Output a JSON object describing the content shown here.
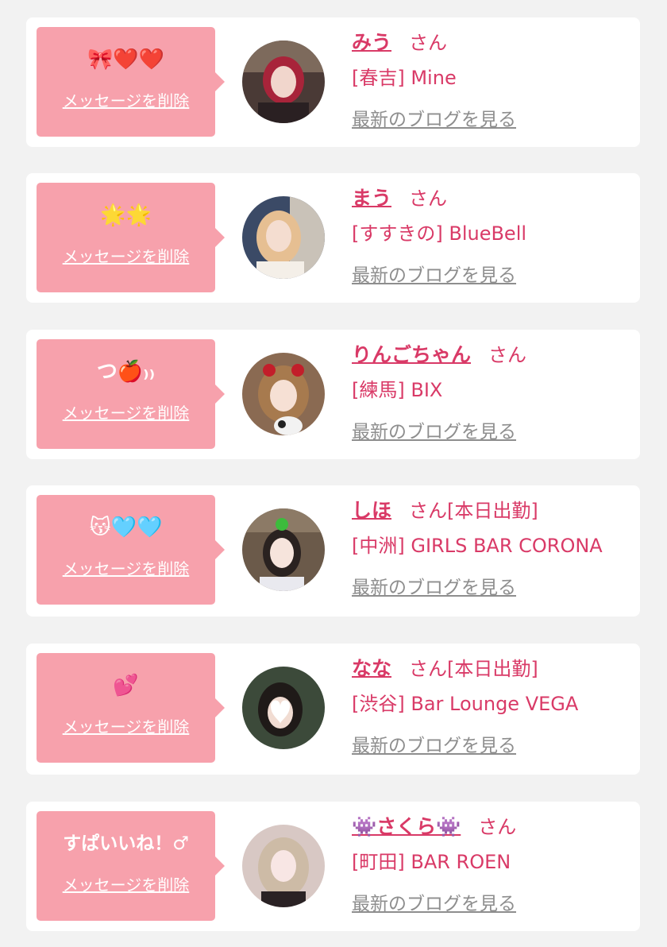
{
  "delete_label": "メッセージを削除",
  "blog_label": "最新のブログを見る",
  "san_label": "さん",
  "colors": {
    "background": "#f2f2f2",
    "card": "#ffffff",
    "bubble": "#f7a1ac",
    "accent_text": "#d93a67",
    "link_gray": "#8e8e8e"
  },
  "items": [
    {
      "message": "🎀❤️❤️",
      "name": "みう",
      "status": "",
      "shop": "[春吉] Mine"
    },
    {
      "message": "🌟🌟",
      "name": "まう",
      "status": "",
      "shop": "[すすきの] BlueBell"
    },
    {
      "message": "つ🍎₎₎",
      "name": "りんごちゃん",
      "status": "",
      "shop": "[練馬] BIX"
    },
    {
      "message": "😽🩵🩵",
      "name": "しほ",
      "status": "[本日出勤]",
      "shop": "[中洲] GIRLS BAR CORONA"
    },
    {
      "message": "💕",
      "name": "なな",
      "status": "[本日出勤]",
      "shop": "[渋谷] Bar Lounge VEGA"
    },
    {
      "message": "すぱいいね！♂",
      "name": "👾さくら👾",
      "status": "",
      "shop": "[町田] BAR ROEN"
    }
  ]
}
